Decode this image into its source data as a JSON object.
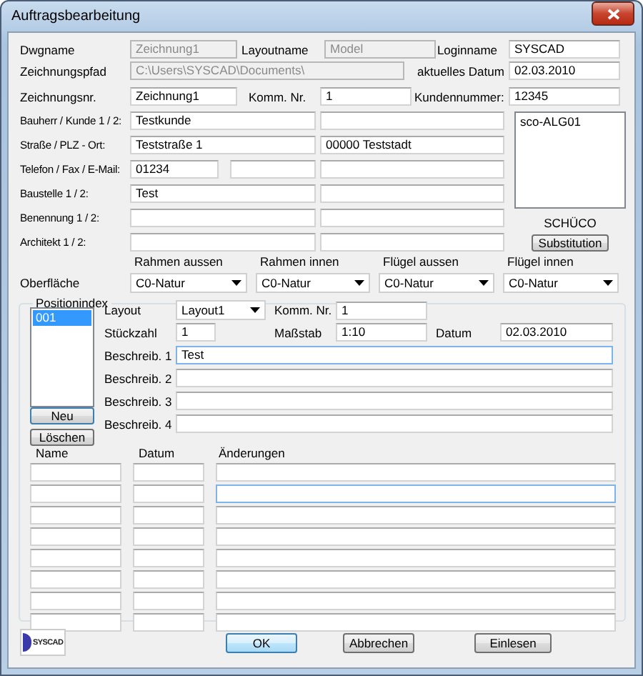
{
  "window": {
    "title": "Auftragsbearbeitung"
  },
  "header_rows": [
    [
      {
        "label": "Dwgname",
        "value": "Zeichnung1",
        "disabled": true
      },
      {
        "label": "Layoutname",
        "value": "Model",
        "disabled": true
      },
      {
        "label": "Loginname",
        "value": "SYSCAD",
        "disabled": false
      }
    ],
    [
      {
        "label": "Zeichnungspfad",
        "value": "C:\\Users\\SYSCAD\\Documents\\",
        "disabled": true
      },
      {
        "label": "aktuelles Datum",
        "value": "02.03.2010",
        "disabled": false
      }
    ],
    [
      {
        "label": "Zeichnungsnr.",
        "value": "Zeichnung1",
        "disabled": false
      },
      {
        "label": "Komm. Nr.",
        "value": "1",
        "disabled": false
      },
      {
        "label": "Kundennummer:",
        "value": "12345",
        "disabled": false
      }
    ]
  ],
  "address_rows": [
    {
      "label": "Bauherr / Kunde 1 / 2:",
      "fields": [
        {
          "kind": "text",
          "value": "Testkunde"
        },
        {
          "kind": "text"
        }
      ]
    },
    {
      "label": "Straße / PLZ - Ort:",
      "fields": [
        {
          "kind": "text",
          "value": "Teststraße 1"
        },
        {
          "kind": "text",
          "value": "00000 Teststadt"
        }
      ]
    },
    {
      "label": "Telefon / Fax / E-Mail:",
      "fields": [
        {
          "kind": "text",
          "value": "01234"
        },
        {
          "kind": "text"
        },
        {
          "kind": "text"
        }
      ]
    },
    {
      "label": "Baustelle 1 / 2:",
      "fields": [
        {
          "kind": "text",
          "value": "Test"
        },
        {
          "kind": "text"
        }
      ]
    },
    {
      "label": "Benennung 1 / 2:",
      "fields": [
        {
          "kind": "text"
        },
        {
          "kind": "text"
        }
      ]
    },
    {
      "label": "Architekt 1 / 2:",
      "fields": [
        {
          "kind": "text"
        },
        {
          "kind": "text"
        }
      ]
    }
  ],
  "profile_list": {
    "items": [
      {
        "label": "sco-ALG01",
        "selected": false
      }
    ],
    "caption": "SCHÜCO",
    "button": "Substitution"
  },
  "surface": {
    "label": "Oberfläche",
    "columns": [
      {
        "header": "Rahmen aussen",
        "value": "C0-Natur"
      },
      {
        "header": "Rahmen innen",
        "value": "C0-Natur"
      },
      {
        "header": "Flügel aussen",
        "value": "C0-Natur"
      },
      {
        "header": "Flügel innen",
        "value": "C0-Natur"
      }
    ]
  },
  "position": {
    "title": "Positionindex",
    "items": [
      {
        "label": "001",
        "selected": true
      }
    ],
    "buttons": [
      "Neu",
      "Löschen"
    ],
    "layout": {
      "label": "Layout",
      "value": "Layout1"
    },
    "komm": {
      "label": "Komm. Nr.",
      "value": "1"
    },
    "stueckzahl": {
      "label": "Stückzahl",
      "value": "1"
    },
    "massstab": {
      "label": "Maßstab",
      "value": "1:10"
    },
    "datum": {
      "label": "Datum",
      "value": "02.03.2010"
    },
    "descriptions": [
      {
        "label": "Beschreib. 1",
        "value": "Test",
        "focused": true
      },
      {
        "label": "Beschreib. 2",
        "focused": false
      },
      {
        "label": "Beschreib. 3",
        "focused": false
      },
      {
        "label": "Beschreib. 4",
        "focused": false
      }
    ]
  },
  "changes": {
    "columns": [
      "Name",
      "Datum",
      "Änderungen"
    ],
    "rows": [
      {
        "focused": false
      },
      {
        "focused": true
      },
      {
        "focused": false
      },
      {
        "focused": false
      },
      {
        "focused": false
      },
      {
        "focused": false
      },
      {
        "focused": false
      },
      {
        "focused": false
      }
    ]
  },
  "logo": {
    "text": "SYSCAD"
  },
  "buttons": [
    {
      "label": "OK",
      "default": true
    },
    {
      "label": "Abbrechen",
      "default": false
    },
    {
      "label": "Einlesen",
      "default": false
    }
  ]
}
